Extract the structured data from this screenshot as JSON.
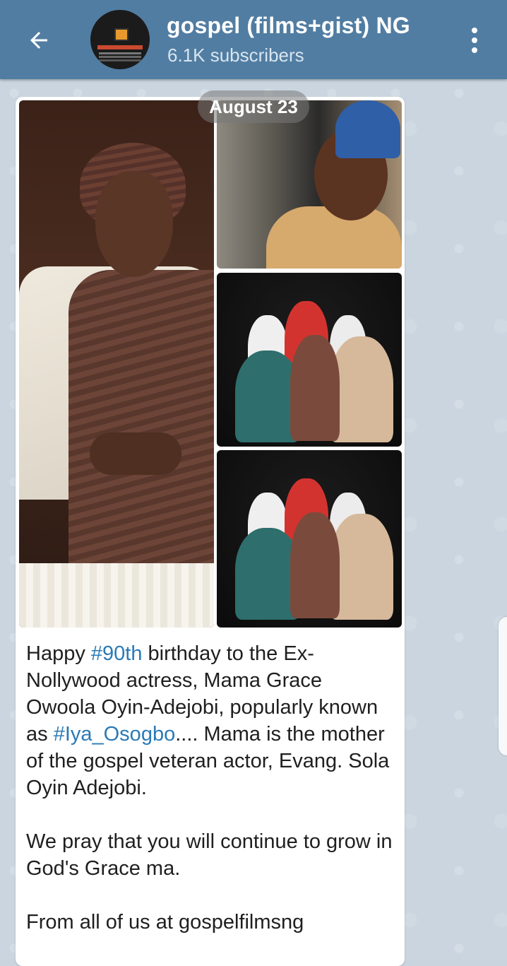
{
  "header": {
    "title": "gospel (films+gist) NG",
    "subscribers": "6.1K subscribers",
    "avatar_icon": "channel-avatar-icon",
    "back_icon": "arrow-left-icon",
    "menu_icon": "more-vertical-icon"
  },
  "date_pill": "August 23",
  "message": {
    "photos": [
      "elderly-woman-portrait",
      "man-in-blue-cap-portrait",
      "family-group-photo-1",
      "family-group-photo-2"
    ],
    "caption": {
      "p1_part1": "Happy ",
      "hashtag_1": "#90th",
      "p1_part2": " birthday to the Ex-Nollywood actress, Mama Grace Owoola Oyin-Adejobi, popularly known as ",
      "hashtag_2": "#Iya_Osogbo",
      "p1_part3": ".... Mama is the mother of the gospel veteran actor, Evang. Sola Oyin Adejobi.",
      "p2": "We pray that you will continue to grow in God's Grace ma.",
      "p3": "From all of us at gospelfilmsng"
    }
  },
  "colors": {
    "header_bg": "#517da2",
    "chat_bg": "#cad5df",
    "link": "#2a7ab6"
  }
}
